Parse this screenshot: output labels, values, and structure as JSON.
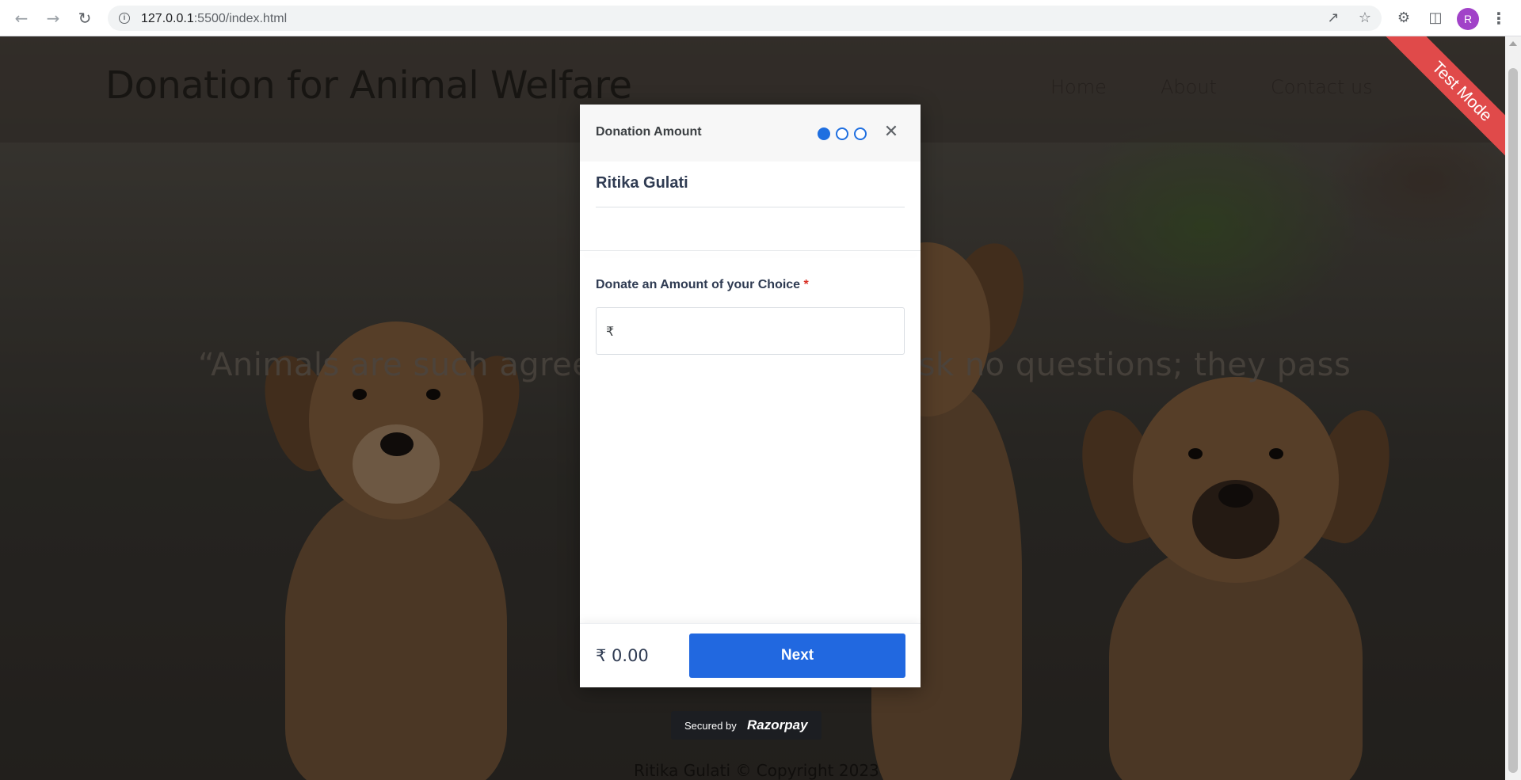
{
  "browser": {
    "url_host": "127.0.0.1",
    "url_rest": ":5500/index.html",
    "profile_initial": "R",
    "icons": [
      "back-arrow-icon",
      "forward-arrow-icon",
      "reload-icon",
      "site-info-icon",
      "share-icon",
      "star-icon",
      "extensions-icon",
      "side-panel-icon",
      "menu-icon"
    ]
  },
  "site": {
    "title": "Donation for Animal Welfare",
    "nav": [
      "Home",
      "About",
      "Contact us"
    ],
    "quote": "“Animals are such agreeable friends—they ask no questions; they pass",
    "footer": "Ritika Gulati © Copyright 2023"
  },
  "ribbon": {
    "label": "Test Mode",
    "color": "#e04a4a"
  },
  "checkout": {
    "step_title": "Donation Amount",
    "steps_total": 3,
    "active_step": 1,
    "payee_name": "Ritika Gulati",
    "amount_label": "Donate an Amount of your Choice",
    "required_marker": "*",
    "currency_symbol": "₹",
    "amount_value": "",
    "total": "₹ 0.00",
    "next_label": "Next",
    "accent": "#2168e0"
  },
  "secured_badge": {
    "prefix": "Secured by",
    "brand": "Razorpay"
  }
}
